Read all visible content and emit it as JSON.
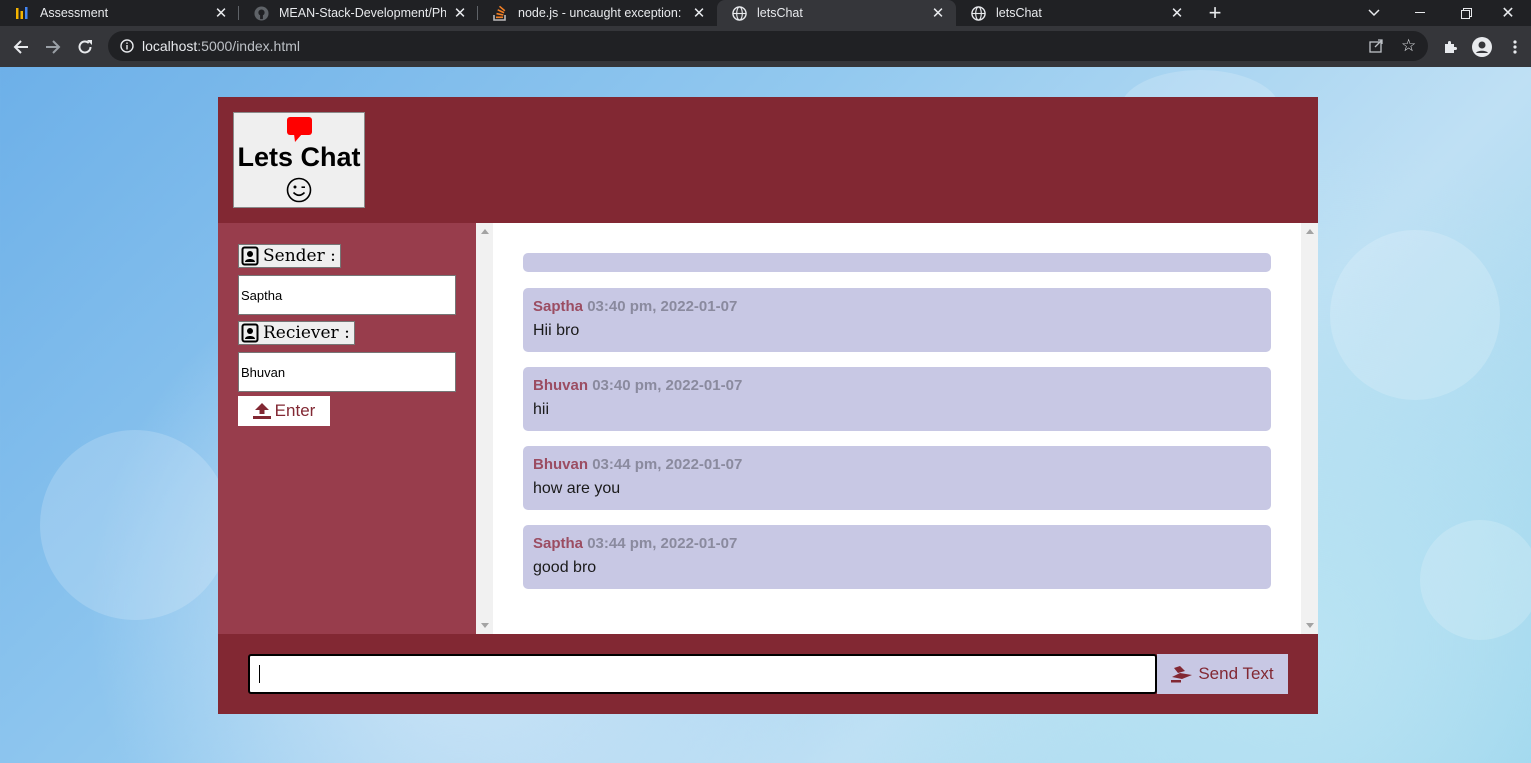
{
  "browser": {
    "tabs": [
      {
        "title": "Assessment",
        "icon": "bar-chart-icon"
      },
      {
        "title": "MEAN-Stack-Development/Phase",
        "icon": "github-icon"
      },
      {
        "title": "node.js - uncaught exception: Syn",
        "icon": "stackoverflow-icon"
      },
      {
        "title": "letsChat",
        "icon": "globe-icon",
        "active": true
      },
      {
        "title": "letsChat",
        "icon": "globe-icon"
      }
    ],
    "new_tab": "+",
    "address": {
      "host": "localhost",
      "rest": ":5000/index.html"
    }
  },
  "app": {
    "logo": {
      "title": "Lets Chat",
      "emoji": "😉"
    },
    "sender_label": "Sender :",
    "sender_value": "Saptha",
    "receiver_label": "Reciever :",
    "receiver_value": "Bhuvan",
    "enter_label": "Enter",
    "messages": [
      {
        "sender": "Saptha",
        "time": "03:40 pm, 2022-01-07",
        "text": "Hii bro"
      },
      {
        "sender": "Bhuvan",
        "time": "03:40 pm, 2022-01-07",
        "text": "hii"
      },
      {
        "sender": "Bhuvan",
        "time": "03:44 pm, 2022-01-07",
        "text": "how are you"
      },
      {
        "sender": "Saptha",
        "time": "03:44 pm, 2022-01-07",
        "text": "good bro"
      }
    ],
    "message_input_value": "",
    "send_label": "Send Text"
  },
  "colors": {
    "header": "#822833",
    "sidebar": "#983d4c",
    "bubble": "#c8c8e4",
    "accent_red": "#ff0000"
  }
}
